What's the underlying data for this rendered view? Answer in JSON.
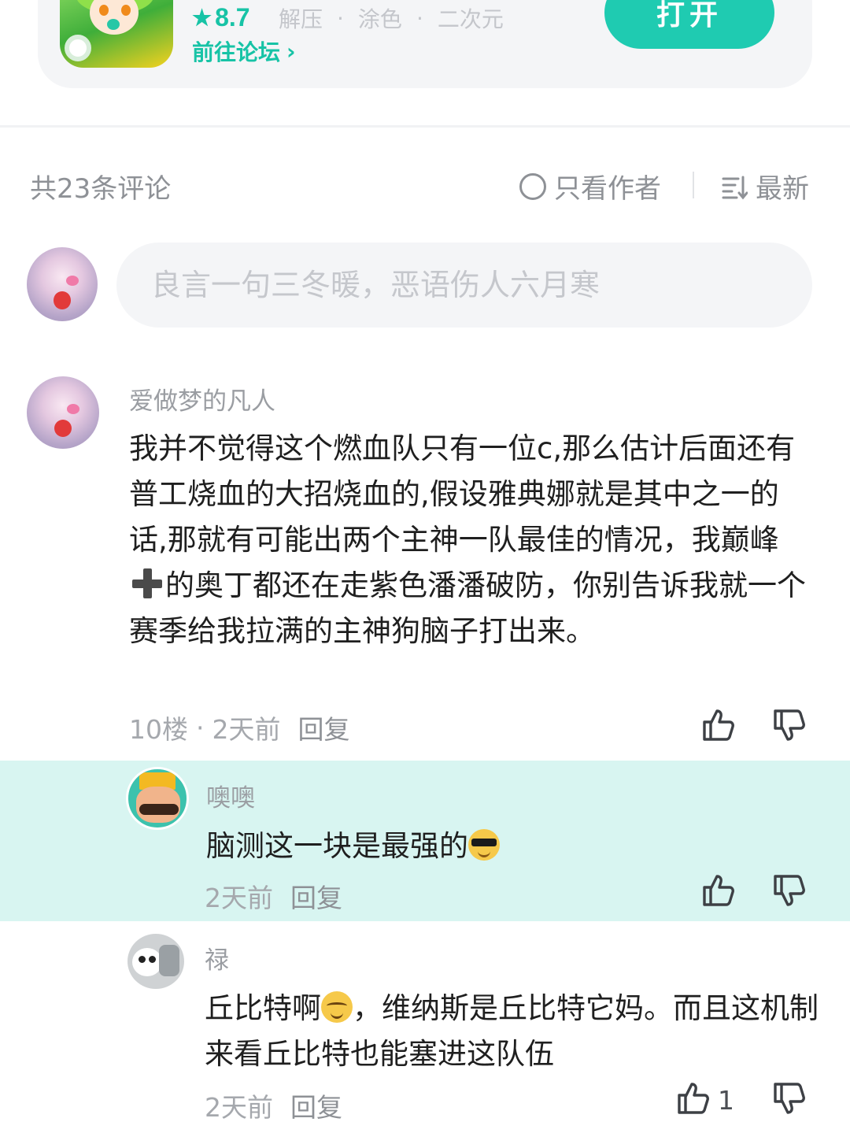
{
  "app": {
    "rating_star": "★",
    "rating": "8.7",
    "tags": [
      "解压",
      "涂色",
      "二次元"
    ],
    "forum_link": "前往论坛",
    "forum_chevron": "›",
    "open_label": "打开",
    "accent_color": "#1fcbb1"
  },
  "comments_header": {
    "count_label": "共23条评论",
    "author_only_label": "只看作者",
    "sort_label": "最新"
  },
  "input": {
    "placeholder": "良言一句三冬暖，恶语伤人六月寒"
  },
  "comment": {
    "username": "爱做梦的凡人",
    "text_part1": "我并不觉得这个燃血队只有一位c,那么估计后面还有普工烧血的大招烧血的,假设雅典娜就是其中之一的话,那就有可能出两个主神一队最佳的情况，我巅峰",
    "text_emoji": "heavy-plus-emoji",
    "text_part2": "的奥丁都还在走紫色潘潘破防，你别告诉我就一个赛季给我拉满的主神狗脑子打出来。",
    "floor": "10楼",
    "meta_sep": "·",
    "time": "2天前",
    "reply_label": "回复"
  },
  "replies": [
    {
      "username": "噢噢",
      "text": "脑测这一块是最强的",
      "emoji": "cool-sunglasses-emoji",
      "time": "2天前",
      "reply_label": "回复",
      "highlight_color": "#d8f5f1"
    },
    {
      "username": "禄",
      "text_part1": "丘比特啊",
      "emoji": "blush-smile-emoji",
      "text_part2": "，维纳斯是丘比特它妈。而且这机制来看丘比特也能塞进这队伍",
      "time": "2天前",
      "reply_label": "回复",
      "like_count": "1"
    }
  ]
}
